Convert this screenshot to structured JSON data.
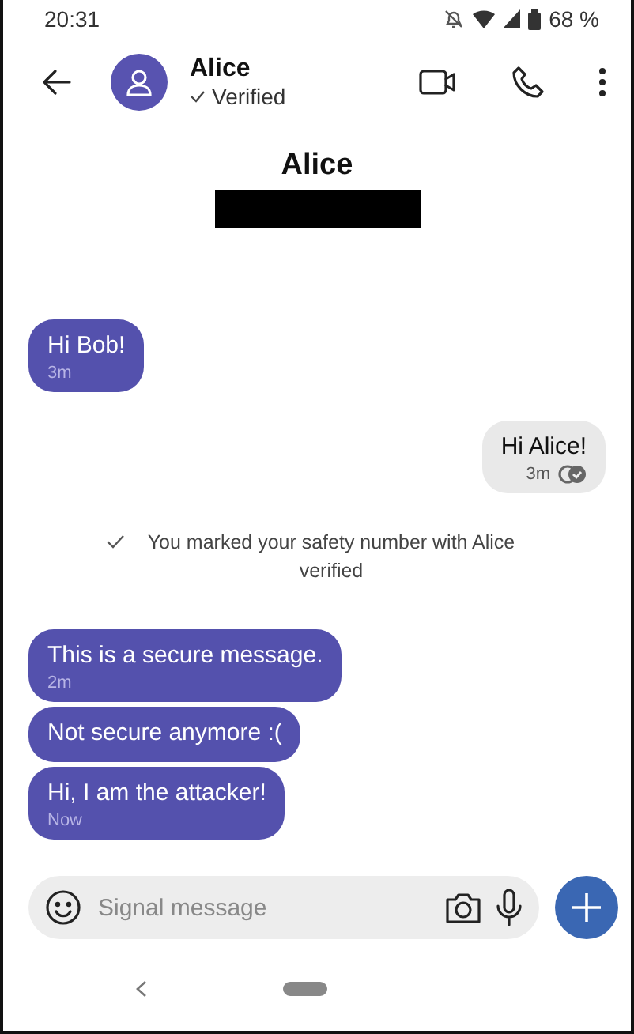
{
  "status_bar": {
    "time": "20:31",
    "battery": "68 %"
  },
  "header": {
    "name": "Alice",
    "subtitle": "Verified"
  },
  "profile": {
    "name": "Alice",
    "redacted": true
  },
  "messages": [
    {
      "kind": "incoming",
      "text": "Hi Bob!",
      "time": "3m"
    },
    {
      "kind": "outgoing",
      "text": "Hi Alice!",
      "time": "3m",
      "delivered": true
    },
    {
      "kind": "system",
      "text": "You marked your safety number with Alice verified"
    },
    {
      "kind": "incoming",
      "text": "This is a secure message.",
      "time": "2m"
    },
    {
      "kind": "incoming",
      "text": "Not secure anymore :("
    },
    {
      "kind": "incoming",
      "text": "Hi, I am the attacker!",
      "time": "Now"
    }
  ],
  "composer": {
    "placeholder": "Signal message"
  }
}
